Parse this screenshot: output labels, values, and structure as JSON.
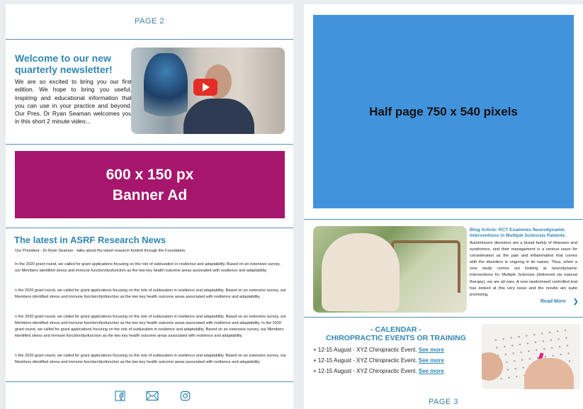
{
  "page2": {
    "label": "PAGE 2",
    "welcome": {
      "title": "Welcome to our new quarterly newsletter!",
      "body": "We are so excited to bring you our first edition. We hope to bring you useful, inspiring and educational information that you can use in your practice and beyond. Our Pres, Dr Ryan Seaman welcomes you in this short 2 minute video..."
    },
    "banner": {
      "line1": "600 x 150 px",
      "line2": "Banner Ad"
    },
    "news": {
      "title": "The latest in ASRF Research News",
      "lead": "Our President - Dr Ryan Seaman - talks about the latest research funded through the Foundation.",
      "paragraphs": [
        "In the 2020 grant round, we called for grant applications focusing on the role of subluxation in resilience and adaptability. Based on an extensive survey, our Members identified stress and immune function/dysfunction as the two key health outcome areas associated with resilience and adaptability.",
        "n the 2020 grant round, we called for grant applications focusing on the role of subluxation in resilience and adaptability. Based on an extensive survey, our Members identified stress and immune function/dysfunction as the two key health outcome areas associated with resilience and adaptability.",
        "n the 2020 grant round, we called for grant applications focusing on the role of subluxation in resilience and adaptability. Based on an extensive survey, our Members identified stress and immune function/dysfunction as the two key health outcome areas associated with resilience and adaptability. In the 2020 grant round, we called for grant applications focusing on the role of subluxation in resilience and adaptability. Based on an extensive survey, our Members identified stress and immune function/dysfunction as the two key health outcome areas associated with resilience and adaptability.",
        "n the 2020 grant round, we called for grant applications focusing on the role of subluxation in resilience and adaptability. Based on an extensive survey, our Members identified stress and immune function/dysfunction as the two key health outcome areas associated with resilience and adaptability."
      ]
    },
    "social": [
      "facebook-icon",
      "email-icon",
      "instagram-icon"
    ]
  },
  "page3": {
    "label": "PAGE 3",
    "half_ad": "Half page 750 x 540 pixels",
    "blog": {
      "title": "Blog Article: RCT Examines Neurodynamic Interventions in Multiple Sclerosis Patients.",
      "body": "Autoimmune disorders are a broad family of illnesses and syndromes, and their management is a serious issue for consideration as the pain and inflammation that comes with the disorders is ongoing in its nature. Thus, when a new study comes out looking at neurodynamic interventions for Multiple Sclerosis (delivered via manual therapy), we are all ears. A new randomised controlled trial has looked at this very issue and the results are quite promising.",
      "read_more": "Read More"
    },
    "calendar": {
      "title": "- CALENDAR -\nCHIROPRACTIC EVENTS OR TRAINING",
      "events": [
        {
          "text": "+ 12-15 August - XYZ Chiropractic Event.",
          "link": "See more"
        },
        {
          "text": "+ 12-15 August - XYZ Chiropractic Event.",
          "link": "See more"
        },
        {
          "text": "+ 12-15 August - XYZ Chiropractic Event.",
          "link": "See more"
        }
      ]
    }
  },
  "colors": {
    "accent": "#2f86b4",
    "banner": "#a6166c",
    "half_ad": "#4193dc"
  }
}
